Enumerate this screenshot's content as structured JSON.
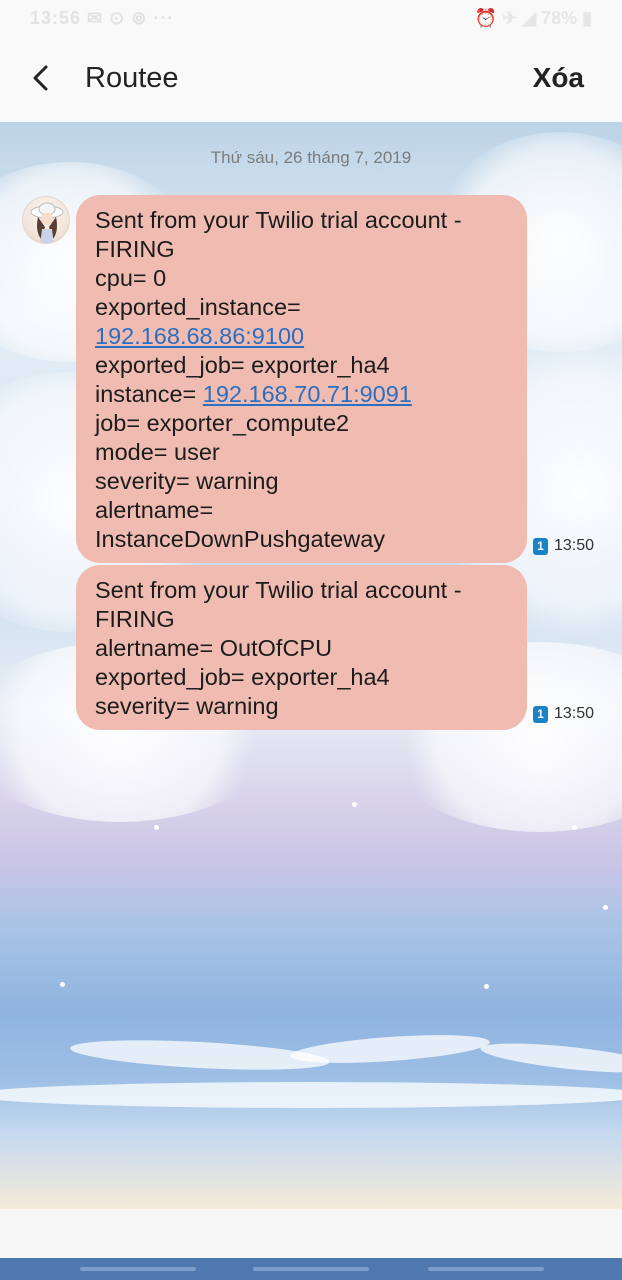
{
  "status_bar": {
    "left": "13:56 ✉ ⊙ ⊚ ···",
    "right": "⏰ ✈ ◢ 78% ▮"
  },
  "header": {
    "title": "Routee",
    "delete_label": "Xóa"
  },
  "chat": {
    "date": "Thứ sáu, 26 tháng 7, 2019",
    "messages": [
      {
        "lines": [
          "Sent from your Twilio trial account -",
          "FIRING",
          "cpu= 0",
          "exported_instance=",
          "192.168.68.86:9100",
          "exported_job= exporter_ha4",
          "instance= ",
          "192.168.70.71:9091",
          "job= exporter_compute2",
          "mode= user",
          "severity= warning",
          "alertname=",
          "InstanceDownPushgateway"
        ],
        "sim": "1",
        "time": "13:50"
      },
      {
        "lines": [
          "Sent from your Twilio trial account -",
          "FIRING",
          "alertname= OutOfCPU",
          "exported_job= exporter_ha4",
          "severity= warning"
        ],
        "sim": "1",
        "time": "13:50"
      }
    ]
  },
  "colors": {
    "bubble": "#f0bcb2",
    "link": "#2a6fc1",
    "nav_bar": "#4f78b0",
    "sim_badge": "#1a82c7"
  }
}
